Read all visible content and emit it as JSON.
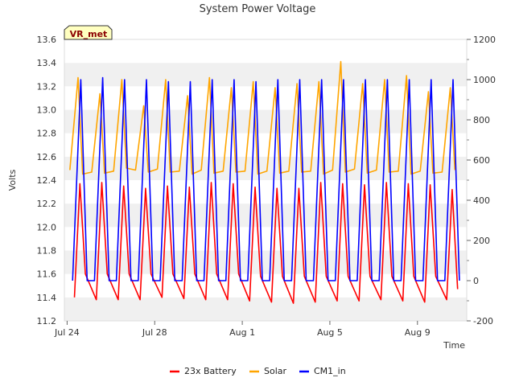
{
  "chart_data": {
    "type": "line",
    "title": "System Power Voltage",
    "xlabel": "Time",
    "ylabel": "Volts",
    "y2label": "",
    "badge": "VR_met",
    "x_range": [
      "2023-07-23T21:00",
      "2023-08-11T06:00"
    ],
    "x_ticks": [
      {
        "date": "2023-07-24",
        "label": "Jul 24"
      },
      {
        "date": "2023-07-28",
        "label": "Jul 28"
      },
      {
        "date": "2023-08-01",
        "label": "Aug 1"
      },
      {
        "date": "2023-08-05",
        "label": "Aug 5"
      },
      {
        "date": "2023-08-09",
        "label": "Aug 9"
      }
    ],
    "ylim": [
      11.2,
      13.6
    ],
    "y_ticks": [
      "11.2",
      "11.4",
      "11.6",
      "11.8",
      "12.0",
      "12.2",
      "12.4",
      "12.6",
      "12.8",
      "13.0",
      "13.2",
      "13.4",
      "13.6"
    ],
    "y2lim": [
      -200,
      1200
    ],
    "y2_ticks": [
      "-200",
      "0",
      "200",
      "400",
      "600",
      "800",
      "1000",
      "1200"
    ],
    "grid": "horizontal bands",
    "legend": "bottom-center",
    "series": [
      {
        "name": "23x Battery",
        "axis": "left",
        "color": "#ff0000",
        "x": [
          "2023-07-24T08:00",
          "2023-07-24T14:00",
          "2023-07-24T20:00",
          "2023-07-25T08:00",
          "2023-07-25T14:00",
          "2023-07-25T20:00",
          "2023-07-26T08:00",
          "2023-07-26T14:00",
          "2023-07-26T20:00",
          "2023-07-27T08:00",
          "2023-07-27T14:00",
          "2023-07-27T20:00",
          "2023-07-28T08:00",
          "2023-07-28T14:00",
          "2023-07-28T20:00",
          "2023-07-29T08:00",
          "2023-07-29T14:00",
          "2023-07-29T20:00",
          "2023-07-30T08:00",
          "2023-07-30T14:00",
          "2023-07-30T20:00",
          "2023-07-31T08:00",
          "2023-07-31T14:00",
          "2023-07-31T20:00",
          "2023-08-01T08:00",
          "2023-08-01T14:00",
          "2023-08-01T20:00",
          "2023-08-02T08:00",
          "2023-08-02T14:00",
          "2023-08-02T20:00",
          "2023-08-03T08:00",
          "2023-08-03T14:00",
          "2023-08-03T20:00",
          "2023-08-04T08:00",
          "2023-08-04T14:00",
          "2023-08-04T20:00",
          "2023-08-05T08:00",
          "2023-08-05T14:00",
          "2023-08-05T20:00",
          "2023-08-06T08:00",
          "2023-08-06T14:00",
          "2023-08-06T20:00",
          "2023-08-07T08:00",
          "2023-08-07T14:00",
          "2023-08-07T20:00",
          "2023-08-08T08:00",
          "2023-08-08T14:00",
          "2023-08-08T20:00",
          "2023-08-09T08:00",
          "2023-08-09T14:00",
          "2023-08-09T20:00",
          "2023-08-10T08:00",
          "2023-08-10T14:00",
          "2023-08-10T20:00"
        ],
        "values": [
          11.4,
          12.37,
          11.6,
          11.38,
          12.38,
          11.6,
          11.38,
          12.35,
          11.6,
          11.38,
          12.33,
          11.6,
          11.4,
          12.35,
          11.6,
          11.39,
          12.34,
          11.6,
          11.38,
          12.38,
          11.6,
          11.38,
          12.37,
          11.6,
          11.37,
          12.34,
          11.58,
          11.36,
          12.33,
          11.58,
          11.35,
          12.33,
          11.58,
          11.36,
          12.38,
          11.58,
          11.37,
          12.37,
          11.58,
          11.37,
          12.36,
          11.58,
          11.38,
          12.38,
          11.58,
          11.37,
          12.37,
          11.58,
          11.36,
          12.36,
          11.58,
          11.38,
          12.32,
          11.47
        ]
      },
      {
        "name": "Solar",
        "axis": "right",
        "color": "#ffa500",
        "x": [
          "2023-07-24T03:00",
          "2023-07-24T12:00",
          "2023-07-24T17:00",
          "2023-07-25T03:00",
          "2023-07-25T12:00",
          "2023-07-25T17:00",
          "2023-07-26T03:00",
          "2023-07-26T12:00",
          "2023-07-26T17:00",
          "2023-07-27T03:00",
          "2023-07-27T12:00",
          "2023-07-27T17:00",
          "2023-07-28T03:00",
          "2023-07-28T12:00",
          "2023-07-28T17:00",
          "2023-07-29T03:00",
          "2023-07-29T12:00",
          "2023-07-29T17:00",
          "2023-07-30T03:00",
          "2023-07-30T12:00",
          "2023-07-30T17:00",
          "2023-07-31T03:00",
          "2023-07-31T12:00",
          "2023-07-31T17:00",
          "2023-08-01T03:00",
          "2023-08-01T12:00",
          "2023-08-01T17:00",
          "2023-08-02T03:00",
          "2023-08-02T12:00",
          "2023-08-02T17:00",
          "2023-08-03T03:00",
          "2023-08-03T12:00",
          "2023-08-03T17:00",
          "2023-08-04T03:00",
          "2023-08-04T12:00",
          "2023-08-04T17:00",
          "2023-08-05T03:00",
          "2023-08-05T12:00",
          "2023-08-05T17:00",
          "2023-08-06T03:00",
          "2023-08-06T12:00",
          "2023-08-06T17:00",
          "2023-08-07T03:00",
          "2023-08-07T12:00",
          "2023-08-07T17:00",
          "2023-08-08T03:00",
          "2023-08-08T12:00",
          "2023-08-08T17:00",
          "2023-08-09T03:00",
          "2023-08-09T12:00",
          "2023-08-09T17:00",
          "2023-08-10T03:00",
          "2023-08-10T12:00",
          "2023-08-10T17:00"
        ],
        "values": [
          550,
          1010,
          530,
          540,
          930,
          535,
          545,
          1000,
          560,
          550,
          870,
          540,
          555,
          1000,
          540,
          545,
          920,
          530,
          550,
          1010,
          535,
          545,
          960,
          540,
          545,
          990,
          530,
          545,
          960,
          535,
          545,
          980,
          540,
          545,
          990,
          530,
          550,
          1090,
          540,
          555,
          980,
          535,
          550,
          1000,
          540,
          545,
          1020,
          530,
          545,
          940,
          535,
          540,
          960,
          550
        ]
      },
      {
        "name": "CM1_in",
        "axis": "right",
        "color": "#0000ff",
        "x": [
          "2023-07-24T06:00",
          "2023-07-24T15:00",
          "2023-07-24T22:00",
          "2023-07-25T06:00",
          "2023-07-25T15:00",
          "2023-07-25T22:00",
          "2023-07-26T06:00",
          "2023-07-26T15:00",
          "2023-07-26T22:00",
          "2023-07-27T06:00",
          "2023-07-27T15:00",
          "2023-07-27T22:00",
          "2023-07-28T06:00",
          "2023-07-28T15:00",
          "2023-07-28T22:00",
          "2023-07-29T06:00",
          "2023-07-29T15:00",
          "2023-07-29T22:00",
          "2023-07-30T06:00",
          "2023-07-30T15:00",
          "2023-07-30T22:00",
          "2023-07-31T06:00",
          "2023-07-31T15:00",
          "2023-07-31T22:00",
          "2023-08-01T06:00",
          "2023-08-01T15:00",
          "2023-08-01T22:00",
          "2023-08-02T06:00",
          "2023-08-02T15:00",
          "2023-08-02T22:00",
          "2023-08-03T06:00",
          "2023-08-03T15:00",
          "2023-08-03T22:00",
          "2023-08-04T06:00",
          "2023-08-04T15:00",
          "2023-08-04T22:00",
          "2023-08-05T06:00",
          "2023-08-05T15:00",
          "2023-08-05T22:00",
          "2023-08-06T06:00",
          "2023-08-06T15:00",
          "2023-08-06T22:00",
          "2023-08-07T06:00",
          "2023-08-07T15:00",
          "2023-08-07T22:00",
          "2023-08-08T06:00",
          "2023-08-08T15:00",
          "2023-08-08T22:00",
          "2023-08-09T06:00",
          "2023-08-09T15:00",
          "2023-08-09T22:00",
          "2023-08-10T06:00",
          "2023-08-10T15:00",
          "2023-08-10T22:00"
        ],
        "values": [
          0,
          1000,
          0,
          0,
          1010,
          0,
          0,
          1000,
          0,
          0,
          1000,
          0,
          0,
          990,
          0,
          0,
          990,
          0,
          0,
          1000,
          0,
          0,
          1000,
          0,
          0,
          990,
          0,
          0,
          1000,
          0,
          0,
          1000,
          0,
          0,
          1000,
          0,
          0,
          1000,
          0,
          0,
          1000,
          0,
          0,
          1000,
          0,
          0,
          1000,
          0,
          0,
          1000,
          0,
          0,
          1000,
          0
        ]
      }
    ]
  }
}
